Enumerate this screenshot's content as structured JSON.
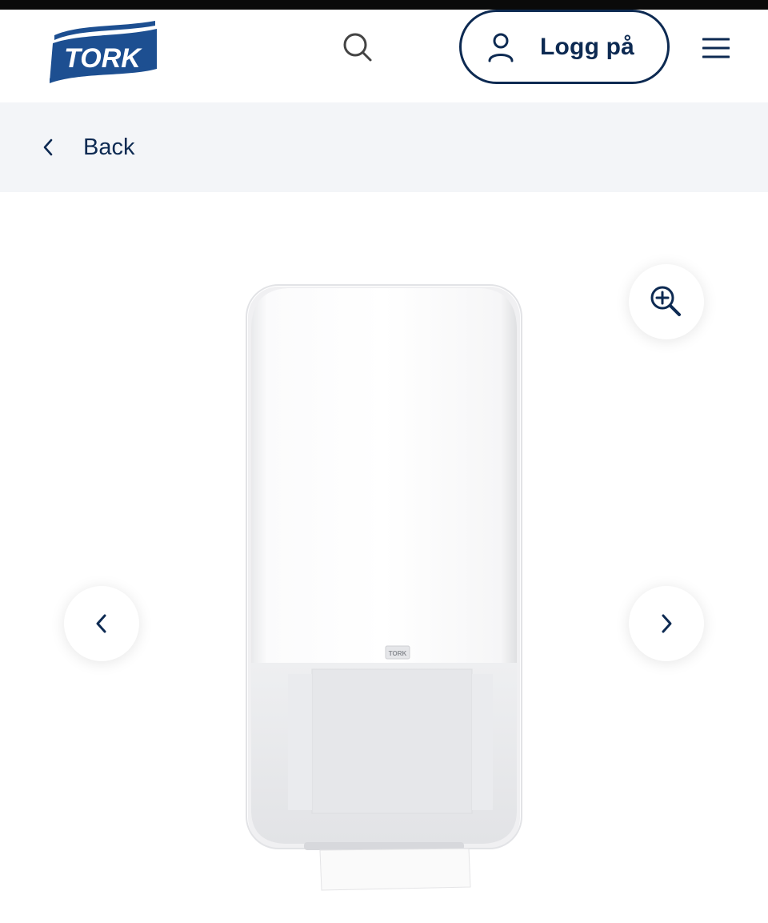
{
  "header": {
    "brand": "TORK",
    "login_label": "Logg på"
  },
  "nav": {
    "back_label": "Back"
  },
  "product_image": {
    "dispenser_logo": "TORK"
  },
  "icons": {
    "search": "search-icon",
    "user": "user-icon",
    "menu": "hamburger-menu-icon",
    "back": "chevron-left-icon",
    "zoom": "zoom-in-icon",
    "prev": "chevron-left-icon",
    "next": "chevron-right-icon"
  },
  "colors": {
    "brand_navy": "#0d2a52",
    "back_bar_bg": "#f3f5f8",
    "logo_blue": "#1d4f91"
  }
}
